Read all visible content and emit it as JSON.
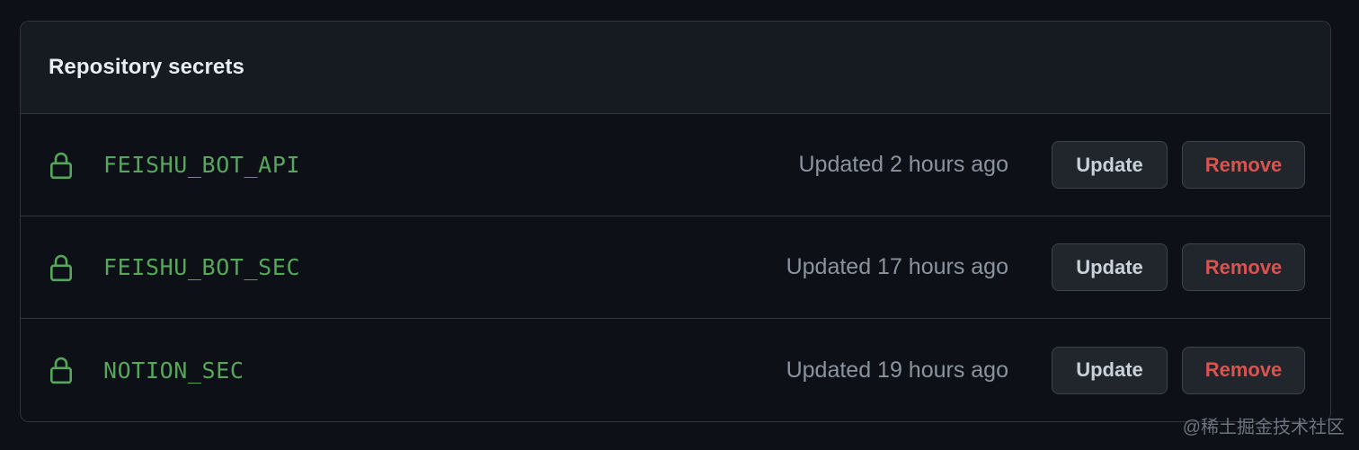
{
  "panel": {
    "title": "Repository secrets"
  },
  "secrets": [
    {
      "name": "FEISHU_BOT_API",
      "updated": "Updated 2 hours ago",
      "update_label": "Update",
      "remove_label": "Remove"
    },
    {
      "name": "FEISHU_BOT_SEC",
      "updated": "Updated 17 hours ago",
      "update_label": "Update",
      "remove_label": "Remove"
    },
    {
      "name": "NOTION_SEC",
      "updated": "Updated 19 hours ago",
      "update_label": "Update",
      "remove_label": "Remove"
    }
  ],
  "watermark": "@稀土掘金技术社区",
  "colors": {
    "background": "#0d1117",
    "header": "#161b22",
    "secret_name": "#56a65b",
    "remove_text": "#d9534f",
    "muted_text": "#8b949e"
  },
  "icons": {
    "row_icon": "lock-icon"
  }
}
